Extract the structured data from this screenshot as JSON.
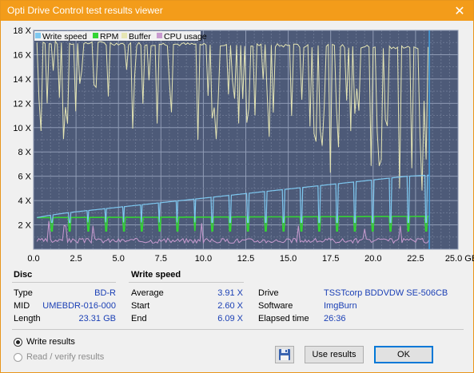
{
  "window": {
    "title": "Opti Drive Control test results viewer",
    "close_glyph": "✕"
  },
  "chart_data": {
    "type": "line",
    "legend": [
      "Write speed",
      "RPM",
      "Buffer",
      "CPU usage"
    ],
    "colors": {
      "write_speed": "#7ec8f0",
      "rpm": "#33d433",
      "buffer": "#e6e6b4",
      "cpu": "#c99bd0",
      "plot_bg": "#4d5a78",
      "marker": "#42a0e0"
    },
    "xlim": [
      0,
      25
    ],
    "ylim": [
      0,
      18
    ],
    "x_ticks": [
      "0.0",
      "2.5",
      "5.0",
      "7.5",
      "10.0",
      "12.5",
      "15.0",
      "17.5",
      "20.0",
      "22.5",
      "25.0 GB"
    ],
    "y_ticks": [
      "2 X",
      "4 X",
      "6 X",
      "8 X",
      "10 X",
      "12 X",
      "14 X",
      "16 X",
      "18 X"
    ],
    "grid": true,
    "write_speed": {
      "x": [
        0.2,
        1,
        2,
        3,
        4,
        5,
        6,
        7,
        8,
        9,
        10,
        11,
        12,
        13,
        14,
        15,
        16,
        17,
        18,
        19,
        20,
        21,
        22,
        23.31
      ],
      "y": [
        2.6,
        2.8,
        3.0,
        3.15,
        3.3,
        3.45,
        3.6,
        3.75,
        3.9,
        4.05,
        4.2,
        4.35,
        4.5,
        4.65,
        4.8,
        4.95,
        5.1,
        5.25,
        5.4,
        5.55,
        5.7,
        5.85,
        6.0,
        6.09
      ]
    },
    "rpm": {
      "x": [
        0.2,
        23.31
      ],
      "y": [
        2.6,
        2.7
      ]
    },
    "buffer": {
      "x": [
        0.2,
        23.31
      ],
      "y": [
        17,
        16.6
      ]
    },
    "cpu": {
      "x": [
        0.2,
        23.31
      ],
      "y": [
        0.7,
        0.7
      ]
    },
    "end_marker_x": 23.31
  },
  "disc": {
    "title": "Disc",
    "rows": [
      {
        "label": "Type",
        "value": "BD-R"
      },
      {
        "label": "MID",
        "value": "UMEBDR-016-000"
      },
      {
        "label": "Length",
        "value": "23.31 GB"
      }
    ]
  },
  "write_speed": {
    "title": "Write speed",
    "rows": [
      {
        "label": "Average",
        "value": "3.91 X"
      },
      {
        "label": "Start",
        "value": "2.60 X"
      },
      {
        "label": "End",
        "value": "6.09 X"
      }
    ]
  },
  "info": {
    "rows": [
      {
        "label": "Drive",
        "value": "TSSTcorp  BDDVDW SE-506CB"
      },
      {
        "label": "Software",
        "value": "ImgBurn"
      },
      {
        "label": "Elapsed time",
        "value": "26:36"
      }
    ]
  },
  "options": {
    "write_results": "Write results",
    "read_verify": "Read / verify results"
  },
  "buttons": {
    "use_results": "Use results",
    "ok": "OK"
  }
}
